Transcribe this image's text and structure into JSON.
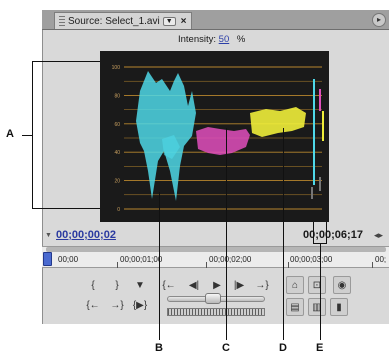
{
  "tab": {
    "title": "Source: Select_1.avi"
  },
  "intensity": {
    "label": "Intensity:",
    "value": "50",
    "unit": "%"
  },
  "scope": {
    "ticks": [
      "100",
      "80",
      "60",
      "40",
      "20",
      "0"
    ],
    "colors": {
      "background": "#1a1a1a",
      "grid": "#b8862d",
      "cyan": "#4fd8e8",
      "magenta": "#e24fbd",
      "yellow": "#f0ee3a"
    }
  },
  "timecode": {
    "current": "00;00;00;02",
    "duration": "00;00;06;17"
  },
  "ruler": {
    "labels": [
      "00;00",
      "00;00;01;00",
      "00;00;02;00",
      "00;00;03;00",
      "00;"
    ]
  },
  "callouts": {
    "a": "A",
    "b": "B",
    "c": "C",
    "d": "D",
    "e": "E"
  },
  "icons": {
    "tab_grip": "grip-icon",
    "tab_dropdown": "dropdown-icon",
    "tab_close": "close-icon",
    "panel_menu": "panel-menu-icon"
  }
}
